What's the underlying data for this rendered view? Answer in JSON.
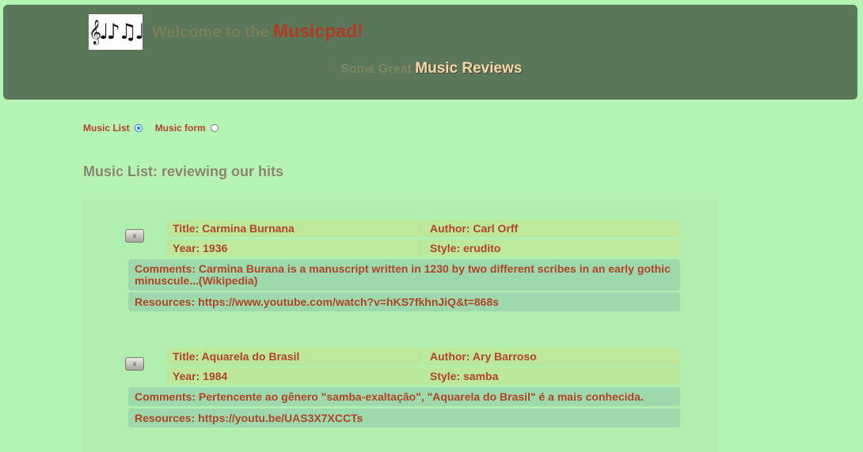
{
  "header": {
    "logo_glyphs": "𝄞♩♪♫♩",
    "welcome_prefix": "Welcome to the",
    "brand": "Musicpad!",
    "subtitle_small": "Some Great",
    "subtitle_big": "Music Reviews"
  },
  "nav": {
    "music_list_label": "Music List",
    "music_form_label": "Music form",
    "selected": "Music List"
  },
  "list_title": "Music List: reviewing our hits",
  "entries": [
    {
      "delete_label": "x",
      "title": "Title: Carmina Burnana",
      "author": "Author: Carl Orff",
      "year": "Year: 1936",
      "style": "Style: erudito",
      "comments": "Comments: Carmina Burana is a manuscript written in 1230 by two different scribes in an early gothic minuscule...(Wikipedia)",
      "resources": "Resources: https://www.youtube.com/watch?v=hKS7fkhnJiQ&t=868s"
    },
    {
      "delete_label": "x",
      "title": "Title: Aquarela do Brasil",
      "author": "Author: Ary Barroso",
      "year": "Year: 1984",
      "style": "Style: samba",
      "comments": "Comments: Pertencente ao gênero \"samba-exaltação\", \"Aquarela do Brasil\" é a mais conhecida.",
      "resources": "Resources: https://youtu.be/UAS3X7XCCTs"
    }
  ],
  "colors": {
    "background": "#b4f4b4",
    "header": "#5b775b",
    "brand": "#b03a22",
    "text": "#b04428",
    "cell_light": "#bde89b",
    "cell_dark": "#9dd9ad"
  }
}
